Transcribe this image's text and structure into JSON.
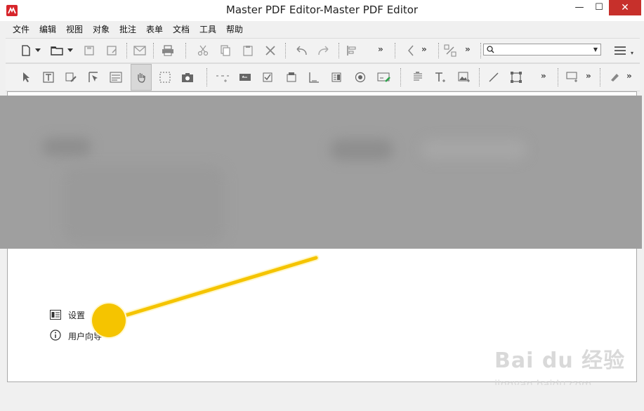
{
  "window": {
    "title": "Master PDF Editor-Master PDF Editor",
    "min_label": "—",
    "max_label": "☐",
    "close_label": "✕"
  },
  "menu": [
    "文件",
    "编辑",
    "视图",
    "对象",
    "批注",
    "表单",
    "文档",
    "工具",
    "帮助"
  ],
  "toolbar": {
    "overflow_label": "»",
    "search_placeholder": ""
  },
  "popup_menu": {
    "items": [
      {
        "label": "设置",
        "icon": "settings-icon"
      },
      {
        "label": "用户向导",
        "icon": "info-icon"
      }
    ]
  },
  "watermark": {
    "brand": "Bai du 经验",
    "url": "jingyan.baidu.com"
  },
  "colors": {
    "accent_close": "#c7302b",
    "annotation": "#f5c400",
    "app_icon": "#d7252b"
  }
}
